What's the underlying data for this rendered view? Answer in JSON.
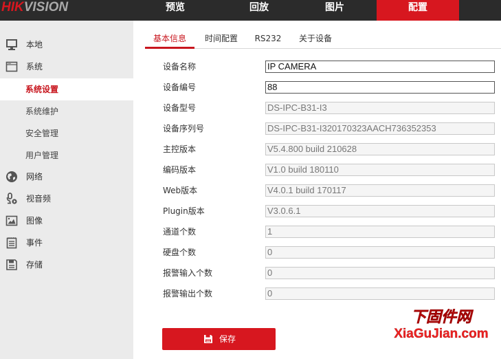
{
  "brand": {
    "part1": "HIK",
    "part2": "VISION"
  },
  "topnav": [
    {
      "label": "预览"
    },
    {
      "label": "回放"
    },
    {
      "label": "图片"
    },
    {
      "label": "配置",
      "active": true
    }
  ],
  "sidebar": {
    "items": [
      {
        "label": "本地",
        "icon": "monitor-icon"
      },
      {
        "label": "系统",
        "icon": "window-icon"
      },
      {
        "label": "系统设置",
        "sub": true,
        "active": true
      },
      {
        "label": "系统维护",
        "sub": true
      },
      {
        "label": "安全管理",
        "sub": true
      },
      {
        "label": "用户管理",
        "sub": true
      },
      {
        "label": "网络",
        "icon": "globe-icon"
      },
      {
        "label": "视音频",
        "icon": "microphone-video-icon"
      },
      {
        "label": "图像",
        "icon": "image-icon"
      },
      {
        "label": "事件",
        "icon": "calendar-list-icon"
      },
      {
        "label": "存储",
        "icon": "floppy-disk-icon"
      }
    ]
  },
  "tabs": [
    {
      "label": "基本信息",
      "active": true
    },
    {
      "label": "时间配置"
    },
    {
      "label": "RS232"
    },
    {
      "label": "关于设备"
    }
  ],
  "form": {
    "rows": [
      {
        "label": "设备名称",
        "value": "IP CAMERA",
        "editable": true
      },
      {
        "label": "设备编号",
        "value": "88",
        "editable": true
      },
      {
        "label": "设备型号",
        "value": "DS-IPC-B31-I3"
      },
      {
        "label": "设备序列号",
        "value": "DS-IPC-B31-I320170323AACH736352353"
      },
      {
        "label": "主控版本",
        "value": "V5.4.800 build 210628"
      },
      {
        "label": "编码版本",
        "value": "V1.0 build 180110"
      },
      {
        "label": "Web版本",
        "value": "V4.0.1 build 170117"
      },
      {
        "label": "Plugin版本",
        "value": "V3.0.6.1"
      },
      {
        "label": "通道个数",
        "value": "1"
      },
      {
        "label": "硬盘个数",
        "value": "0"
      },
      {
        "label": "报警输入个数",
        "value": "0"
      },
      {
        "label": "报警输出个数",
        "value": "0"
      }
    ]
  },
  "save_button": {
    "label": "保存",
    "icon": "floppy-disk-icon"
  },
  "watermark": {
    "cn": "下固件网",
    "en": "XiaGuJian.com"
  },
  "colors": {
    "accent": "#d7171f",
    "topbar": "#2b2b2b",
    "sidebar": "#ebebeb"
  }
}
